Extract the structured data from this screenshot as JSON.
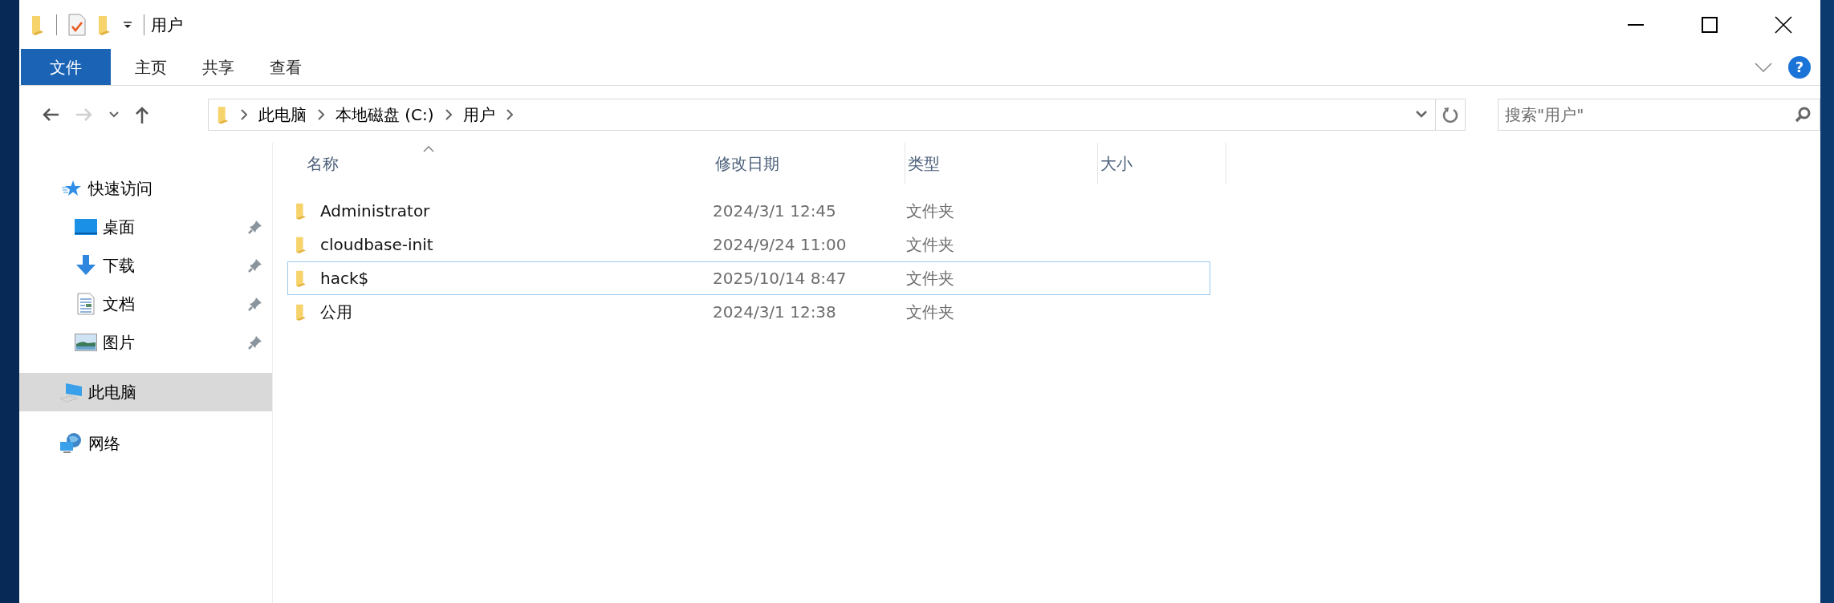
{
  "window": {
    "title": "用户"
  },
  "ribbon_tabs": [
    {
      "label": "文件",
      "kind": "file"
    },
    {
      "label": "主页",
      "kind": "tab"
    },
    {
      "label": "共享",
      "kind": "tab"
    },
    {
      "label": "查看",
      "kind": "tab"
    }
  ],
  "help_button": {
    "label": "?"
  },
  "navigation": {
    "back": {
      "disabled": false
    },
    "forward": {
      "disabled": true
    }
  },
  "breadcrumb": [
    "此电脑",
    "本地磁盘 (C:)",
    "用户"
  ],
  "search": {
    "placeholder": "搜索\"用户\""
  },
  "sidebar": {
    "items": [
      {
        "label": "快速访问",
        "selected": false,
        "children": [
          {
            "label": "桌面",
            "pinned": true,
            "selected": false
          },
          {
            "label": "下载",
            "pinned": true,
            "selected": false
          },
          {
            "label": "文档",
            "pinned": true,
            "selected": false
          },
          {
            "label": "图片",
            "pinned": true,
            "selected": false
          }
        ]
      },
      {
        "label": "此电脑",
        "selected": true
      },
      {
        "label": "网络",
        "selected": false
      }
    ]
  },
  "table": {
    "columns": [
      "名称",
      "修改日期",
      "类型",
      "大小"
    ],
    "rows": [
      {
        "name": "Administrator",
        "modified": "2024/3/1 12:45",
        "type": "文件夹",
        "focused": false
      },
      {
        "name": "cloudbase-init",
        "modified": "2024/9/24 11:00",
        "type": "文件夹",
        "focused": false
      },
      {
        "name": "hack$",
        "modified": "2025/10/14 8:47",
        "type": "文件夹",
        "focused": true
      },
      {
        "name": "公用",
        "modified": "2024/3/1 12:38",
        "type": "文件夹",
        "focused": false
      }
    ]
  }
}
